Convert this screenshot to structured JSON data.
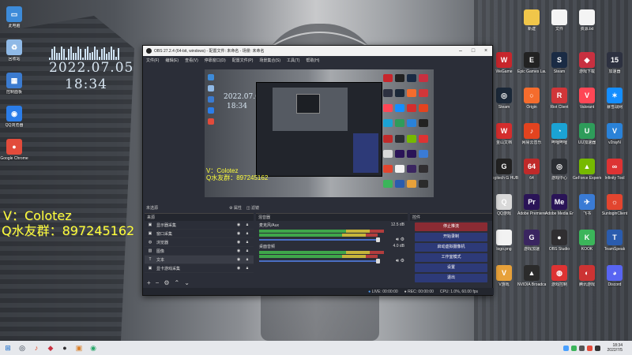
{
  "desktop_left_icons": [
    {
      "id": "computer",
      "label": "此电脑",
      "glyph": "▭",
      "color": "#3d8bd9"
    },
    {
      "id": "recycle",
      "label": "回收站",
      "glyph": "♻",
      "color": "#8fb9e6"
    },
    {
      "id": "control",
      "label": "控制面板",
      "glyph": "▦",
      "color": "#3b7bd0"
    },
    {
      "id": "qqbrowser",
      "label": "QQ浏览器",
      "glyph": "◉",
      "color": "#2b7de9"
    },
    {
      "id": "chrome",
      "label": "Google Chrome",
      "glyph": "●",
      "color": "#e24b3b"
    }
  ],
  "desktop_right_icons": [
    {
      "id": "folder1",
      "label": "新建",
      "glyph": "",
      "color": "#f0c64a"
    },
    {
      "id": "file1",
      "label": "文件",
      "glyph": "",
      "color": "#f4f4f4"
    },
    {
      "id": "file2",
      "label": "资源.txt",
      "glyph": "",
      "color": "#f4f4f4"
    },
    {
      "id": "wegame",
      "label": "WeGame",
      "glyph": "W",
      "color": "#c8262c"
    },
    {
      "id": "epic",
      "label": "Epic Games Launcher",
      "glyph": "E",
      "color": "#222"
    },
    {
      "id": "steamgame",
      "label": "Steam",
      "glyph": "S",
      "color": "#1a2b44"
    },
    {
      "id": "gamedl",
      "label": "游戏下载",
      "glyph": "◆",
      "color": "#c83040"
    },
    {
      "id": "app15",
      "label": "加速器",
      "glyph": "15",
      "color": "#2d3140"
    },
    {
      "id": "steam",
      "label": "Steam",
      "glyph": "◎",
      "color": "#1b2838"
    },
    {
      "id": "origin",
      "label": "Origin",
      "glyph": "○",
      "color": "#f56c2d"
    },
    {
      "id": "riot",
      "label": "Riot Client",
      "glyph": "R",
      "color": "#d13639"
    },
    {
      "id": "valorant",
      "label": "Valorant",
      "glyph": "V",
      "color": "#ff4655"
    },
    {
      "id": "battlenet",
      "label": "暴雪战网",
      "glyph": "✶",
      "color": "#148eff"
    },
    {
      "id": "jinshan",
      "label": "金山文档",
      "glyph": "W",
      "color": "#d42d2d"
    },
    {
      "id": "wangyiyun",
      "label": "网易云音乐",
      "glyph": "♪",
      "color": "#e3431f"
    },
    {
      "id": "bilibili",
      "label": "哔哩哔哩",
      "glyph": "◔",
      "color": "#1ba3d4"
    },
    {
      "id": "uu",
      "label": "UU加速器",
      "glyph": "U",
      "color": "#2e9c5a"
    },
    {
      "id": "vpn",
      "label": "v2rayN",
      "glyph": "V",
      "color": "#2a82d8"
    },
    {
      "id": "logitech",
      "label": "Logitech G HUB",
      "glyph": "G",
      "color": "#222"
    },
    {
      "id": "osu",
      "label": "64",
      "glyph": "64",
      "color": "#c02a2a"
    },
    {
      "id": "gamecenter",
      "label": "游戏中心",
      "glyph": "◎",
      "color": "#2b2e33"
    },
    {
      "id": "geforce",
      "label": "GeForce Experience",
      "glyph": "▲",
      "color": "#76b900"
    },
    {
      "id": "infinity",
      "label": "Infinity Tool",
      "glyph": "∞",
      "color": "#d33"
    },
    {
      "id": "qqgame",
      "label": "QQ游戏",
      "glyph": "Q",
      "color": "#d9d9d9"
    },
    {
      "id": "premiere",
      "label": "Adobe Premiere Pro 2021",
      "glyph": "Pr",
      "color": "#2a1457"
    },
    {
      "id": "media",
      "label": "Adobe Media Encoder",
      "glyph": "Me",
      "color": "#2a1457"
    },
    {
      "id": "feishu",
      "label": "飞书",
      "glyph": "✈",
      "color": "#3a7bd5"
    },
    {
      "id": "sunlogin",
      "label": "SunloginClient",
      "glyph": "☼",
      "color": "#e2452f"
    },
    {
      "id": "logo",
      "label": "logo.png",
      "glyph": "",
      "color": "#f2f2f2"
    },
    {
      "id": "ggame",
      "label": "游戏加速",
      "glyph": "G",
      "color": "#3a2560"
    },
    {
      "id": "obs",
      "label": "OBS Studio",
      "glyph": "●",
      "color": "#302e31"
    },
    {
      "id": "kook",
      "label": "KOOK",
      "glyph": "K",
      "color": "#3bb55a"
    },
    {
      "id": "teamspeak",
      "label": "TeamSpeak",
      "glyph": "T",
      "color": "#2a5cae"
    },
    {
      "id": "vgame",
      "label": "V游戏",
      "glyph": "V",
      "color": "#e7a13a"
    },
    {
      "id": "nvidia",
      "label": "NVIDIA Broadcast",
      "glyph": "▲",
      "color": "#2b2b2b"
    },
    {
      "id": "controller",
      "label": "游戏控制",
      "glyph": "◍",
      "color": "#d33"
    },
    {
      "id": "tencentgame",
      "label": "腾讯游戏",
      "glyph": "◐",
      "color": "#c33"
    },
    {
      "id": "discord",
      "label": "Discord",
      "glyph": "◕",
      "color": "#5865f2"
    }
  ],
  "clock_widget": {
    "date": "2022.07.05",
    "time": "18:34"
  },
  "overlay": {
    "line1": "V：Colotez",
    "line2": "Q水友群：897245162"
  },
  "obs": {
    "title": "OBS 27.2.4 (64-bit, windows) - 配置文件: 未命名 - 场景: 未命名",
    "menu": [
      "文件(F)",
      "编辑(E)",
      "查看(V)",
      "停靠窗口(D)",
      "配置文件(P)",
      "场景集合(S)",
      "工具(T)",
      "帮助(H)"
    ],
    "preview_title": "未选源",
    "properties_label": "属性",
    "filters_label": "滤镜",
    "sources_header": "来源",
    "sources": [
      {
        "icon": "▣",
        "name": "显示器采集"
      },
      {
        "icon": "▣",
        "name": "窗口采集"
      },
      {
        "icon": "◍",
        "name": "浏览器"
      },
      {
        "icon": "▧",
        "name": "图像"
      },
      {
        "icon": "T",
        "name": "文本"
      },
      {
        "icon": "▣",
        "name": "显卡游戏采集"
      }
    ],
    "mixer_header": "混音器",
    "mixer": [
      {
        "name": "麦克风/Aux",
        "db": "12.5 dB"
      },
      {
        "name": "桌面音频",
        "db": "4.0 dB"
      }
    ],
    "controls_header": "控件",
    "controls": [
      "停止推流",
      "开始录制",
      "启动虚拟摄像机",
      "工作室模式",
      "设置",
      "退出"
    ],
    "status": {
      "live": "LIVE: 00:00:00",
      "rec": "REC: 00:00:00",
      "cpu": "CPU: 1.0%, 60.00 fps"
    }
  },
  "taskbar": {
    "apps": [
      {
        "id": "start",
        "glyph": "⊞",
        "color": "#0a64c8"
      },
      {
        "id": "steam",
        "glyph": "◎",
        "color": "#1b2838"
      },
      {
        "id": "netease",
        "glyph": "♪",
        "color": "#e3431f"
      },
      {
        "id": "app3",
        "glyph": "◆",
        "color": "#c83040"
      },
      {
        "id": "obs",
        "glyph": "●",
        "color": "#302e31"
      },
      {
        "id": "app5",
        "glyph": "▣",
        "color": "#d97f2a"
      },
      {
        "id": "app6",
        "glyph": "◉",
        "color": "#2aa86b"
      }
    ],
    "time": "18:34",
    "date": "2022/7/5"
  }
}
